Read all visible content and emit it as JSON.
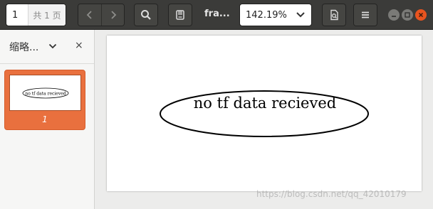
{
  "header": {
    "page_input_value": "1",
    "page_total_label": "共 1 页",
    "document_title": "fra...",
    "zoom_value": "142.19%",
    "icons": [
      "chevron-left-icon",
      "chevron-right-icon",
      "search-icon",
      "annotations-icon",
      "document-properties-icon",
      "menu-icon",
      "window-minimize-icon",
      "window-maximize-icon",
      "window-close-icon"
    ]
  },
  "sidebar": {
    "mode_label": "缩略...",
    "close_label": "×",
    "thumbnails": [
      {
        "page_label": "1",
        "preview_text": "no tf data recieved"
      }
    ]
  },
  "document": {
    "graph_node_label": "no tf data recieved"
  },
  "watermark": "https://blog.csdn.net/qq_42010179",
  "colors": {
    "header_bg": "#3b3b39",
    "accent_selected": "#e9703e",
    "close_button": "#e9541f"
  }
}
